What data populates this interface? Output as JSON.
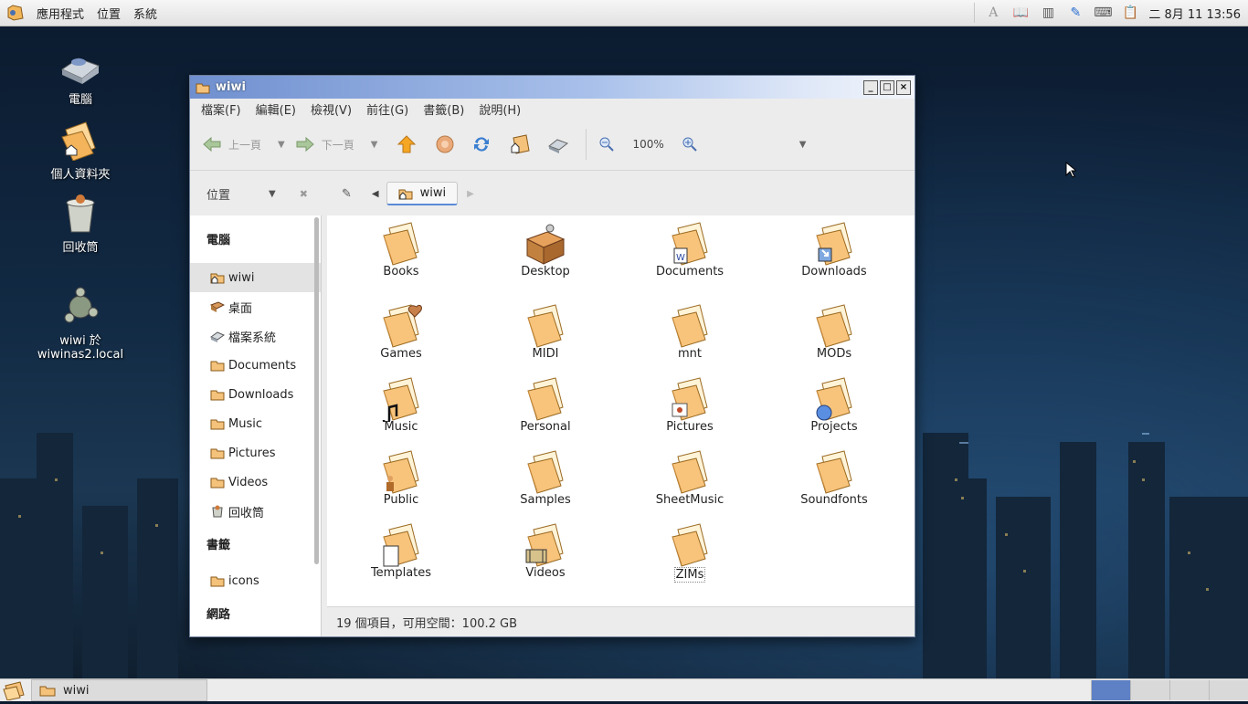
{
  "top_panel": {
    "menus": [
      "應用程式",
      "位置",
      "系統"
    ],
    "clock": "二 8月 11 13:56"
  },
  "desktop_icons": [
    {
      "label": "電腦",
      "icon": "computer-icon"
    },
    {
      "label": "個人資料夾",
      "icon": "home-folder-icon"
    },
    {
      "label": "回收筒",
      "icon": "trash-icon"
    },
    {
      "label": "wiwi 於 wiwinas2.local",
      "icon": "network-share-icon"
    }
  ],
  "window": {
    "title": "wiwi",
    "menubar": [
      "檔案(F)",
      "編輯(E)",
      "檢視(V)",
      "前往(G)",
      "書籤(B)",
      "說明(H)"
    ],
    "toolbar": {
      "back_label": "上一頁",
      "forward_label": "下一頁",
      "zoom_level": "100%"
    },
    "location": {
      "mode_label": "位置",
      "crumb": "wiwi"
    },
    "sidebar": {
      "sections": [
        {
          "header": "電腦",
          "items": [
            "wiwi",
            "桌面",
            "檔案系統",
            "Documents",
            "Downloads",
            "Music",
            "Pictures",
            "Videos",
            "回收筒"
          ]
        },
        {
          "header": "書籤",
          "items": [
            "icons"
          ]
        },
        {
          "header": "網路",
          "items": []
        }
      ],
      "selected": "wiwi"
    },
    "files": [
      "Books",
      "Desktop",
      "Documents",
      "Downloads",
      "Games",
      "MIDI",
      "mnt",
      "MODs",
      "Music",
      "Personal",
      "Pictures",
      "Projects",
      "Public",
      "Samples",
      "SheetMusic",
      "Soundfonts",
      "Templates",
      "Videos",
      "ZIMs"
    ],
    "status": "19 個項目，可用空間：100.2 GB"
  },
  "taskbar": {
    "task_label": "wiwi"
  },
  "colors": {
    "titlebar_start": "#6f8fcf",
    "folder": "#f4c27a",
    "selection": "#e3e3e3",
    "workspace_active": "#5e80c4"
  }
}
